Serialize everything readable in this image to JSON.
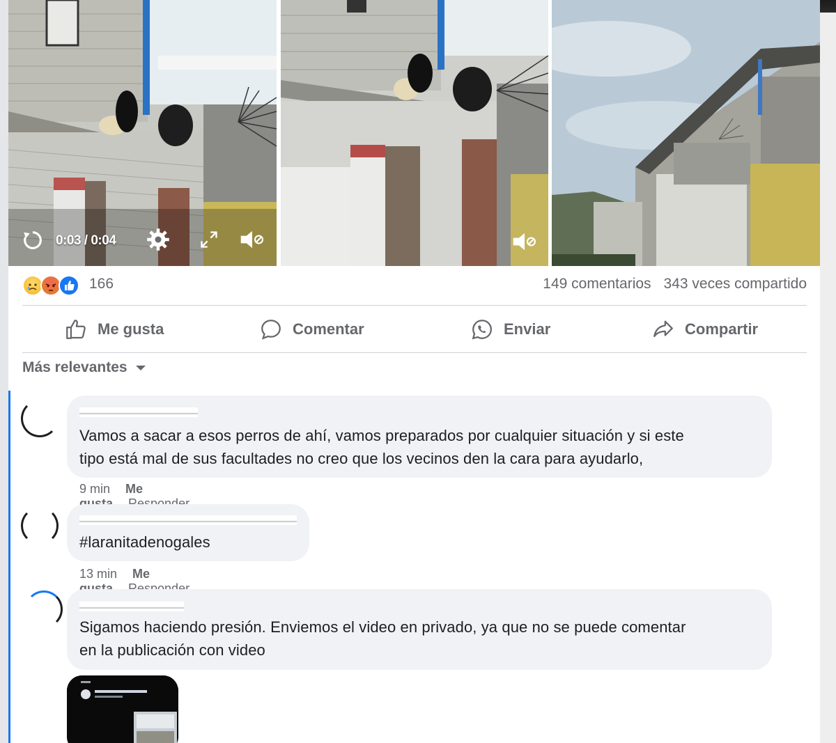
{
  "video": {
    "time": "0:03 / 0:04",
    "icons": [
      "replay-icon",
      "settings-icon",
      "fullscreen-icon",
      "volume-muted-icon"
    ]
  },
  "stats": {
    "reaction_icons": [
      "sad-reaction-icon",
      "angry-reaction-icon",
      "like-reaction-icon"
    ],
    "reaction_count": "166",
    "comments": "149 comentarios",
    "shares": "343 veces compartido"
  },
  "actions": {
    "like": "Me gusta",
    "comment": "Comentar",
    "send": "Enviar",
    "share": "Compartir"
  },
  "sort": {
    "label": "Más relevantes"
  },
  "comments": [
    {
      "text_line1": "Vamos a sacar a esos perros de ahí, vamos preparados por cualquier situación y si este",
      "text_line2": "tipo está mal de sus facultades no creo que los vecinos den la cara para ayudarlo,",
      "time": "9 min",
      "like": "Me gusta",
      "reply": "Responder"
    },
    {
      "text_line1": "#laranitadenogales",
      "time": "13 min",
      "like": "Me gusta",
      "reply": "Responder"
    },
    {
      "text_line1": "Sigamos haciendo presión. Enviemos el video en privado, ya que no se puede comentar",
      "text_line2": "en la publicación con video"
    }
  ],
  "colors": {
    "accent": "#1877f2",
    "secondary_text": "#65676b",
    "bubble": "#f0f2f5"
  }
}
